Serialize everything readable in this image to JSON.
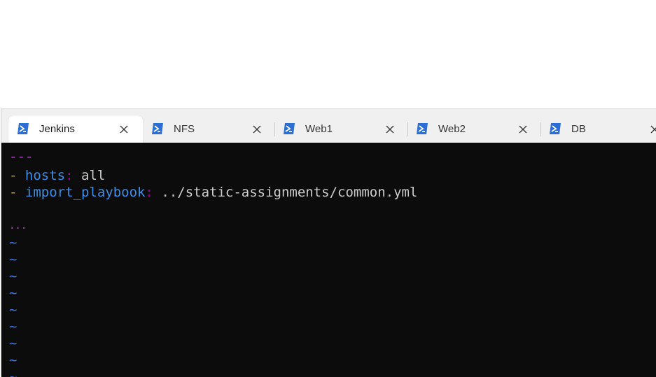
{
  "tabs": [
    {
      "label": "Jenkins",
      "active": true
    },
    {
      "label": "NFS",
      "active": false
    },
    {
      "label": "Web1",
      "active": false
    },
    {
      "label": "Web2",
      "active": false
    },
    {
      "label": "DB",
      "active": false
    }
  ],
  "editor": {
    "doc_start": "---",
    "lines": [
      {
        "dash": "-",
        "key": "hosts",
        "colon": ":",
        "value": " all"
      },
      {
        "dash": "-",
        "key": "import_playbook",
        "colon": ":",
        "value": " ../static-assignments/common.yml"
      }
    ],
    "doc_end": "...",
    "tilde": "~"
  },
  "colors": {
    "terminal_bg": "#0c0c0c",
    "dash": "#c5a000",
    "key": "#3b8eea",
    "marker": "#b148c6",
    "tilde": "#3b78ff",
    "text": "#cccccc"
  }
}
